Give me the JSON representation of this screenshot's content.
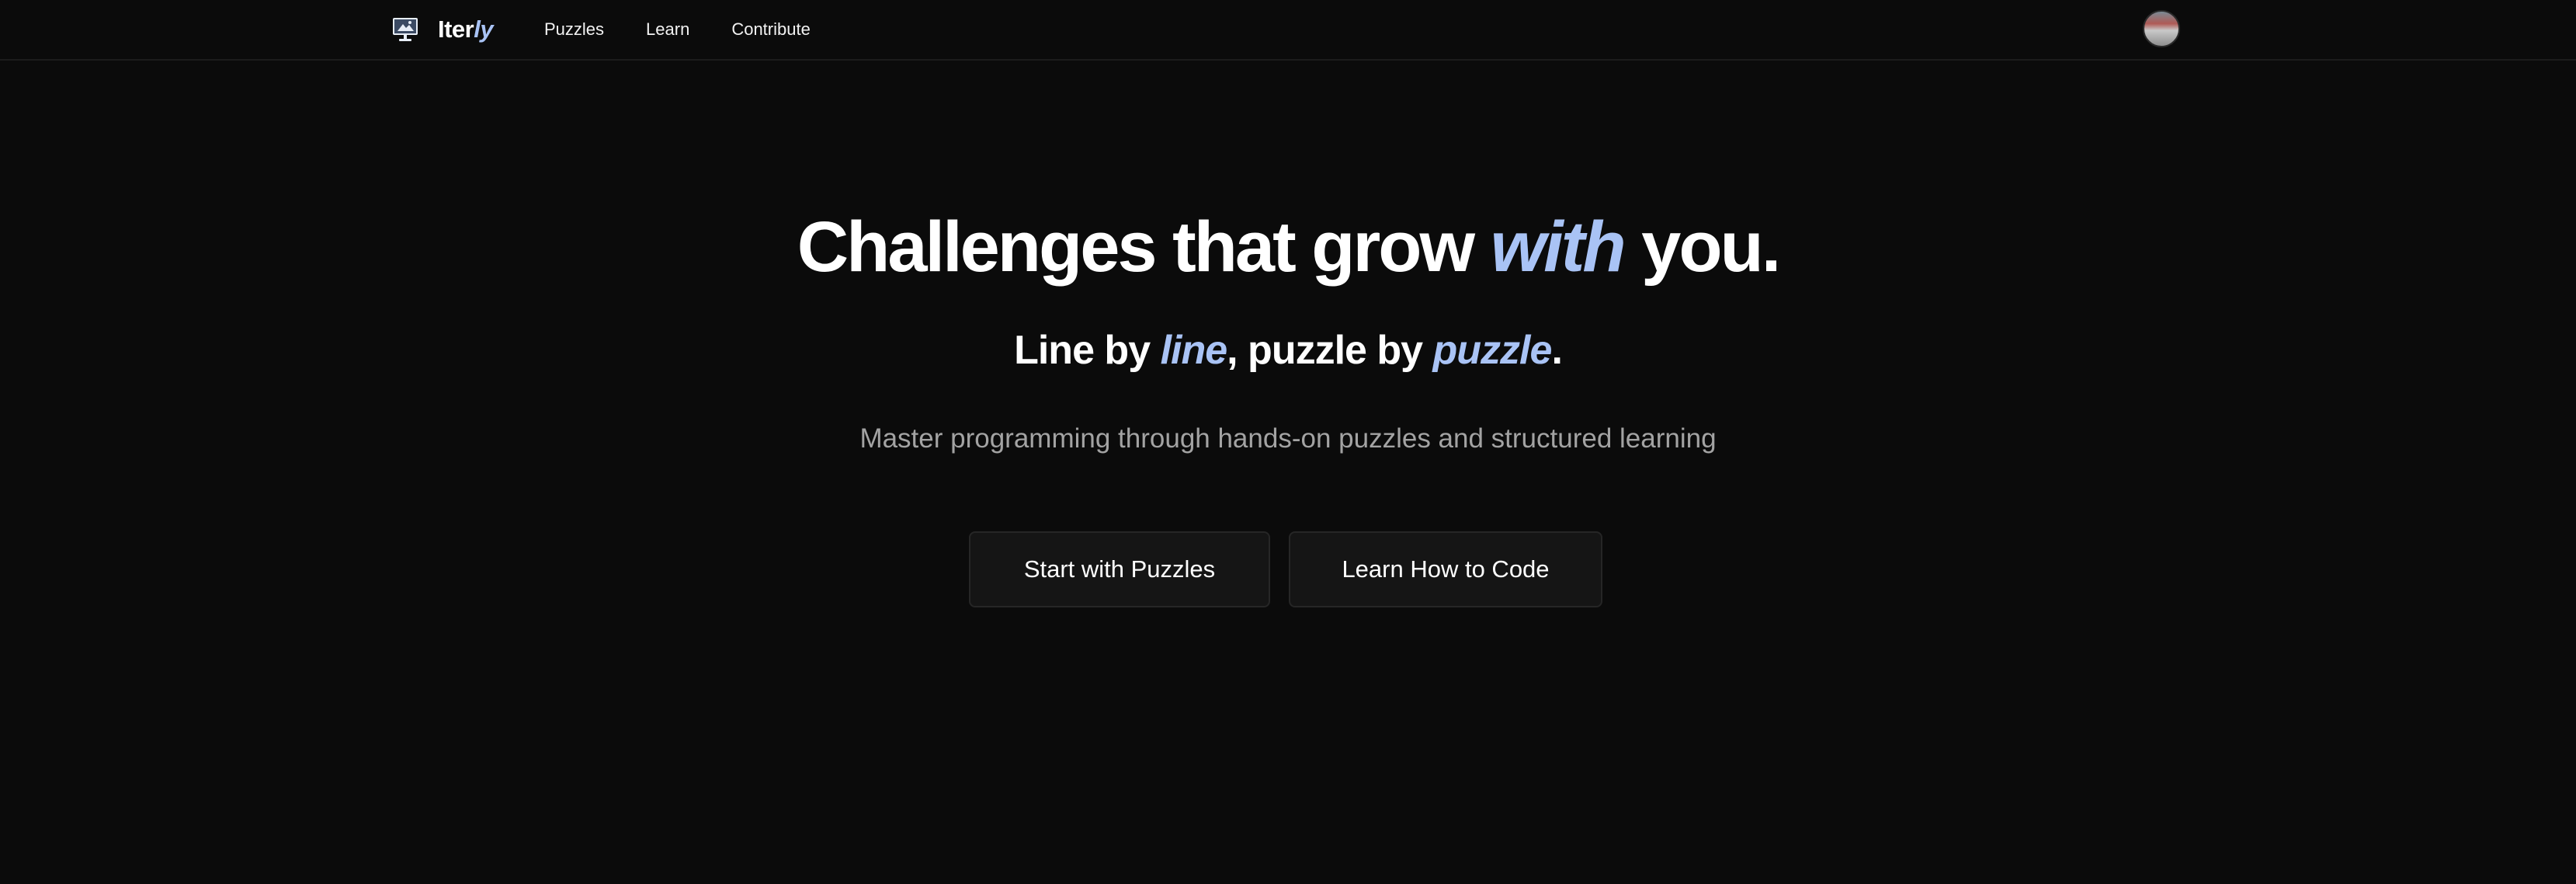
{
  "nav": {
    "brand": {
      "name_main": "Iter",
      "name_accent": "ly",
      "logo_icon": "monitor-logo-icon"
    },
    "links": [
      {
        "label": "Puzzles"
      },
      {
        "label": "Learn"
      },
      {
        "label": "Contribute"
      }
    ],
    "avatar_icon": "user-avatar"
  },
  "hero": {
    "headline": {
      "before": "Challenges that grow ",
      "accent": "with",
      "after": " you."
    },
    "subhead": {
      "part1": "Line by ",
      "accent1": "line",
      "part2": ", puzzle by ",
      "accent2": "puzzle",
      "part3": "."
    },
    "tagline": "Master programming through hands-on puzzles and structured learning",
    "buttons": {
      "primary": "Start with Puzzles",
      "secondary": "Learn How to Code"
    }
  },
  "colors": {
    "background": "#0b0b0b",
    "accent": "#a9c3f5",
    "muted_text": "#a3a3a3",
    "button_bg": "#151515"
  }
}
